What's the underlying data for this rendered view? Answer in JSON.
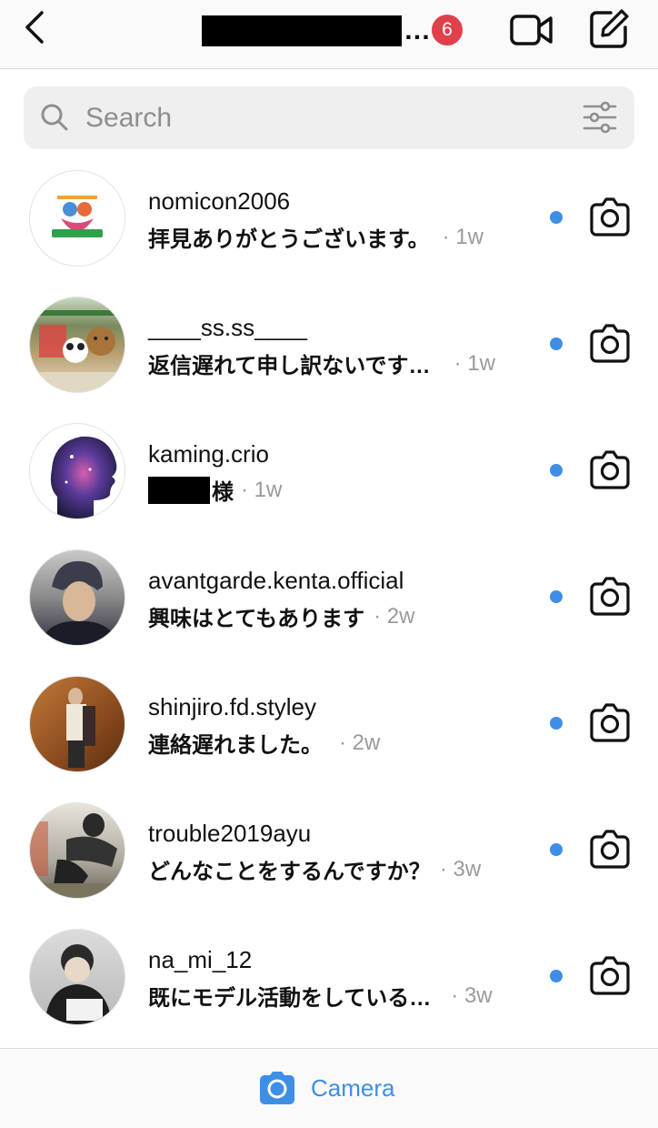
{
  "header": {
    "title_suffix": "…",
    "badge_count": "6",
    "icons": {
      "back": "chevron-left-icon",
      "video": "video-camera-icon",
      "compose": "compose-icon"
    }
  },
  "search": {
    "placeholder": "Search",
    "value": ""
  },
  "conversations": [
    {
      "username": "nomicon2006",
      "message": "拝見ありがとうございます。",
      "time": "· 1w",
      "unread": true
    },
    {
      "username": "____ss.ss____",
      "message": "返信遅れて申し訳ないです…",
      "time": "· 1w",
      "unread": true
    },
    {
      "username": "kaming.crio",
      "message": "様",
      "time": "· 1w",
      "unread": true
    },
    {
      "username": "avantgarde.kenta.official",
      "message": "興味はとてもあります",
      "time": "· 2w",
      "unread": true
    },
    {
      "username": "shinjiro.fd.styley",
      "message": "連絡遅れました。",
      "time": "· 2w",
      "unread": true
    },
    {
      "username": "trouble2019ayu",
      "message": "どんなことをするんですか？",
      "time": "· 3w",
      "unread": true
    },
    {
      "username": "na_mi_12",
      "message": "既にモデル活動をしている…",
      "time": "· 3w",
      "unread": true
    }
  ],
  "bottom_bar": {
    "camera_label": "Camera"
  },
  "colors": {
    "accent": "#3e8ee6",
    "badge": "#e0404c",
    "muted": "#9a9a9a"
  }
}
